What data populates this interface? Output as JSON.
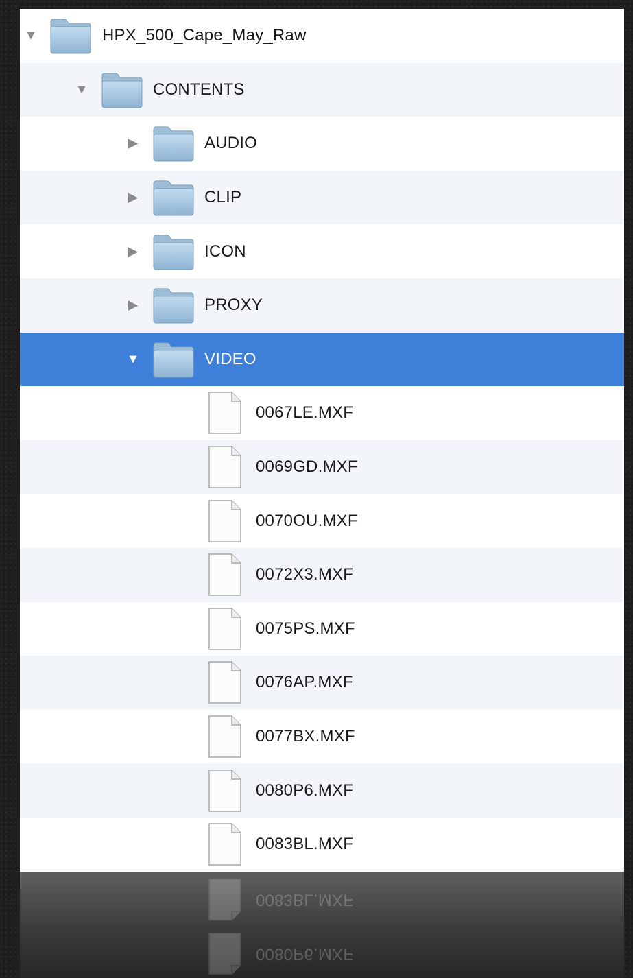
{
  "tree": {
    "rows": [
      {
        "label": "HPX_500_Cape_May_Raw",
        "type": "folder",
        "depth": 0,
        "expanded": true
      },
      {
        "label": "CONTENTS",
        "type": "folder",
        "depth": 1,
        "expanded": true
      },
      {
        "label": "AUDIO",
        "type": "folder",
        "depth": 2,
        "expanded": false
      },
      {
        "label": "CLIP",
        "type": "folder",
        "depth": 2,
        "expanded": false
      },
      {
        "label": "ICON",
        "type": "folder",
        "depth": 2,
        "expanded": false
      },
      {
        "label": "PROXY",
        "type": "folder",
        "depth": 2,
        "expanded": false
      },
      {
        "label": "VIDEO",
        "type": "folder",
        "depth": 2,
        "expanded": true,
        "selected": true
      },
      {
        "label": "0067LE.MXF",
        "type": "file",
        "depth": 3
      },
      {
        "label": "0069GD.MXF",
        "type": "file",
        "depth": 3
      },
      {
        "label": "0070OU.MXF",
        "type": "file",
        "depth": 3
      },
      {
        "label": "0072X3.MXF",
        "type": "file",
        "depth": 3
      },
      {
        "label": "0075PS.MXF",
        "type": "file",
        "depth": 3
      },
      {
        "label": "0076AP.MXF",
        "type": "file",
        "depth": 3
      },
      {
        "label": "0077BX.MXF",
        "type": "file",
        "depth": 3
      },
      {
        "label": "0080P6.MXF",
        "type": "file",
        "depth": 3
      },
      {
        "label": "0083BL.MXF",
        "type": "file",
        "depth": 3
      }
    ]
  },
  "reflection": {
    "rows": [
      {
        "label": "0083BL.MXF"
      },
      {
        "label": "0080P6.MXF"
      }
    ]
  },
  "colors": {
    "selection": "#3d7fd9",
    "alt_row": "#f2f6fb",
    "background": "#1f1f1f"
  },
  "icons": {
    "folder": "folder-icon",
    "file": "file-icon",
    "expanded": "disclosure-triangle-down-icon",
    "collapsed": "disclosure-triangle-right-icon"
  }
}
